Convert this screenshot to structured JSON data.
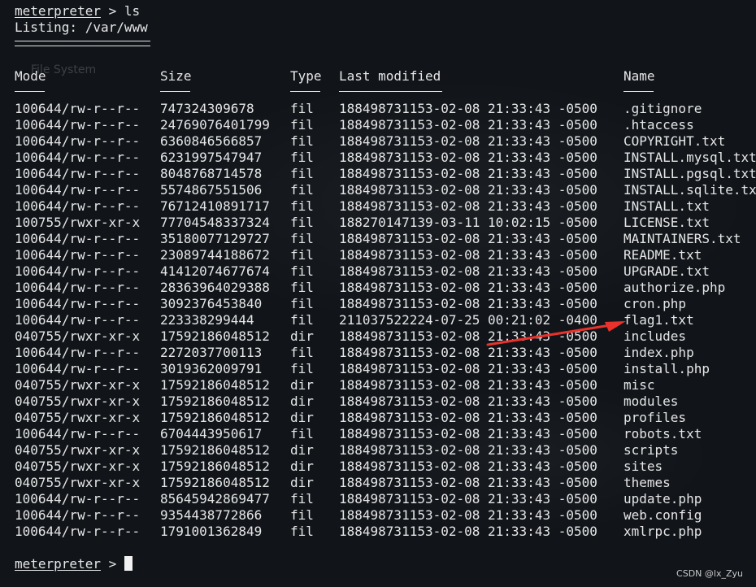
{
  "session": {
    "prompt": "meterpreter",
    "command": "ls",
    "listing_label": "Listing: /var/www"
  },
  "wallpaper_text": "File System",
  "headers": {
    "mode": "Mode",
    "size": "Size",
    "type": "Type",
    "last_modified": "Last modified",
    "name": "Name"
  },
  "rows": [
    {
      "mode": "100644/rw-r--r--",
      "size": "747324309678",
      "type": "fil",
      "modified": "188498731153-02-08 21:33:43 -0500",
      "name": ".gitignore"
    },
    {
      "mode": "100644/rw-r--r--",
      "size": "24769076401799",
      "type": "fil",
      "modified": "188498731153-02-08 21:33:43 -0500",
      "name": ".htaccess"
    },
    {
      "mode": "100644/rw-r--r--",
      "size": "6360846566857",
      "type": "fil",
      "modified": "188498731153-02-08 21:33:43 -0500",
      "name": "COPYRIGHT.txt"
    },
    {
      "mode": "100644/rw-r--r--",
      "size": "6231997547947",
      "type": "fil",
      "modified": "188498731153-02-08 21:33:43 -0500",
      "name": "INSTALL.mysql.txt"
    },
    {
      "mode": "100644/rw-r--r--",
      "size": "8048768714578",
      "type": "fil",
      "modified": "188498731153-02-08 21:33:43 -0500",
      "name": "INSTALL.pgsql.txt"
    },
    {
      "mode": "100644/rw-r--r--",
      "size": "5574867551506",
      "type": "fil",
      "modified": "188498731153-02-08 21:33:43 -0500",
      "name": "INSTALL.sqlite.txt"
    },
    {
      "mode": "100644/rw-r--r--",
      "size": "76712410891717",
      "type": "fil",
      "modified": "188498731153-02-08 21:33:43 -0500",
      "name": "INSTALL.txt"
    },
    {
      "mode": "100755/rwxr-xr-x",
      "size": "77704548337324",
      "type": "fil",
      "modified": "188270147139-03-11 10:02:15 -0500",
      "name": "LICENSE.txt"
    },
    {
      "mode": "100644/rw-r--r--",
      "size": "35180077129727",
      "type": "fil",
      "modified": "188498731153-02-08 21:33:43 -0500",
      "name": "MAINTAINERS.txt"
    },
    {
      "mode": "100644/rw-r--r--",
      "size": "23089744188672",
      "type": "fil",
      "modified": "188498731153-02-08 21:33:43 -0500",
      "name": "README.txt"
    },
    {
      "mode": "100644/rw-r--r--",
      "size": "41412074677674",
      "type": "fil",
      "modified": "188498731153-02-08 21:33:43 -0500",
      "name": "UPGRADE.txt"
    },
    {
      "mode": "100644/rw-r--r--",
      "size": "28363964029388",
      "type": "fil",
      "modified": "188498731153-02-08 21:33:43 -0500",
      "name": "authorize.php"
    },
    {
      "mode": "100644/rw-r--r--",
      "size": "3092376453840",
      "type": "fil",
      "modified": "188498731153-02-08 21:33:43 -0500",
      "name": "cron.php"
    },
    {
      "mode": "100644/rw-r--r--",
      "size": "223338299444",
      "type": "fil",
      "modified": "211037522224-07-25 00:21:02 -0400",
      "name": "flag1.txt"
    },
    {
      "mode": "040755/rwxr-xr-x",
      "size": "17592186048512",
      "type": "dir",
      "modified": "188498731153-02-08 21:33:43 -0500",
      "name": "includes"
    },
    {
      "mode": "100644/rw-r--r--",
      "size": "2272037700113",
      "type": "fil",
      "modified": "188498731153-02-08 21:33:43 -0500",
      "name": "index.php"
    },
    {
      "mode": "100644/rw-r--r--",
      "size": "3019362009791",
      "type": "fil",
      "modified": "188498731153-02-08 21:33:43 -0500",
      "name": "install.php"
    },
    {
      "mode": "040755/rwxr-xr-x",
      "size": "17592186048512",
      "type": "dir",
      "modified": "188498731153-02-08 21:33:43 -0500",
      "name": "misc"
    },
    {
      "mode": "040755/rwxr-xr-x",
      "size": "17592186048512",
      "type": "dir",
      "modified": "188498731153-02-08 21:33:43 -0500",
      "name": "modules"
    },
    {
      "mode": "040755/rwxr-xr-x",
      "size": "17592186048512",
      "type": "dir",
      "modified": "188498731153-02-08 21:33:43 -0500",
      "name": "profiles"
    },
    {
      "mode": "100644/rw-r--r--",
      "size": "6704443950617",
      "type": "fil",
      "modified": "188498731153-02-08 21:33:43 -0500",
      "name": "robots.txt"
    },
    {
      "mode": "040755/rwxr-xr-x",
      "size": "17592186048512",
      "type": "dir",
      "modified": "188498731153-02-08 21:33:43 -0500",
      "name": "scripts"
    },
    {
      "mode": "040755/rwxr-xr-x",
      "size": "17592186048512",
      "type": "dir",
      "modified": "188498731153-02-08 21:33:43 -0500",
      "name": "sites"
    },
    {
      "mode": "040755/rwxr-xr-x",
      "size": "17592186048512",
      "type": "dir",
      "modified": "188498731153-02-08 21:33:43 -0500",
      "name": "themes"
    },
    {
      "mode": "100644/rw-r--r--",
      "size": "85645942869477",
      "type": "fil",
      "modified": "188498731153-02-08 21:33:43 -0500",
      "name": "update.php"
    },
    {
      "mode": "100644/rw-r--r--",
      "size": "9354438772866",
      "type": "fil",
      "modified": "188498731153-02-08 21:33:43 -0500",
      "name": "web.config"
    },
    {
      "mode": "100644/rw-r--r--",
      "size": "1791001362849",
      "type": "fil",
      "modified": "188498731153-02-08 21:33:43 -0500",
      "name": "xmlrpc.php"
    }
  ],
  "annotation": {
    "arrow_icon": "red-arrow-icon",
    "arrow_color": "#e8322b"
  },
  "watermark": "CSDN @lx_Zyu",
  "colors": {
    "background": "#11151a",
    "text": "#e6e6e6"
  }
}
